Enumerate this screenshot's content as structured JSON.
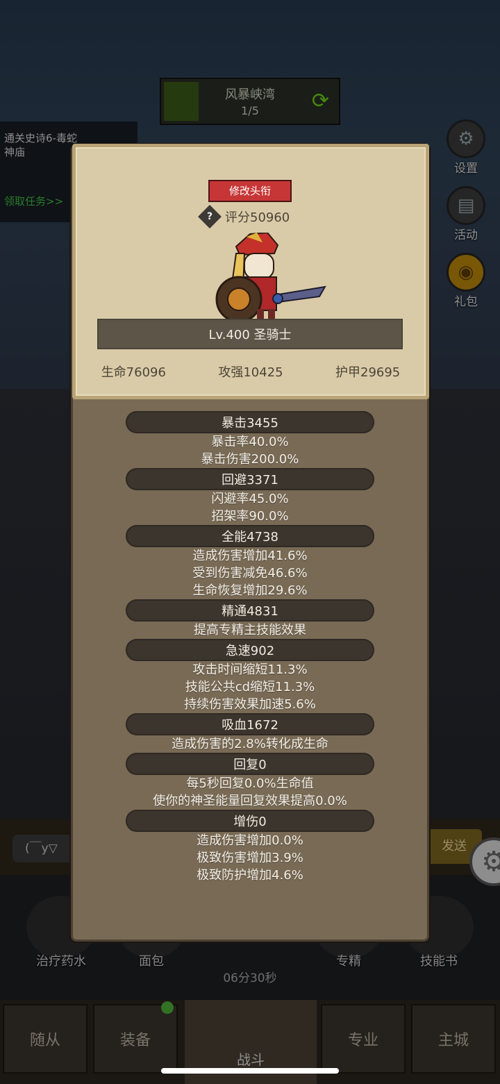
{
  "stage": {
    "name": "风暴峡湾",
    "progress": "1/5"
  },
  "quest": {
    "title": "通关史诗6-毒蛇神庙",
    "claim": "领取任务>>"
  },
  "side_buttons": [
    {
      "label": "设置",
      "icon": "gear-icon"
    },
    {
      "label": "活动",
      "icon": "scroll-icon"
    },
    {
      "label": "礼包",
      "icon": "gift-icon"
    }
  ],
  "profile": {
    "change_title_label": "修改头衔",
    "score_label": "评分50960",
    "name_level": "Lv.400 圣骑士",
    "hp": "生命76096",
    "attack": "攻强10425",
    "armor": "护甲29695"
  },
  "attributes": [
    {
      "header": "暴击3455",
      "lines": [
        "暴击率40.0%",
        "暴击伤害200.0%"
      ]
    },
    {
      "header": "回避3371",
      "lines": [
        "闪避率45.0%",
        "招架率90.0%"
      ]
    },
    {
      "header": "全能4738",
      "lines": [
        "造成伤害增加41.6%",
        "受到伤害减免46.6%",
        "生命恢复增加29.6%"
      ]
    },
    {
      "header": "精通4831",
      "lines": [
        "提高专精主技能效果"
      ]
    },
    {
      "header": "急速902",
      "lines": [
        "攻击时间缩短11.3%",
        "技能公共cd缩短11.3%",
        "持续伤害效果加速5.6%"
      ]
    },
    {
      "header": "吸血1672",
      "lines": [
        "造成伤害的2.8%转化成生命"
      ]
    },
    {
      "header": "回复0",
      "lines": [
        "每5秒回复0.0%生命值",
        "使你的神圣能量回复效果提高0.0%"
      ]
    },
    {
      "header": "增伤0",
      "lines": [
        "造成伤害增加0.0%",
        "极致伤害增加3.9%",
        "极致防护增加4.6%"
      ]
    }
  ],
  "chat": {
    "input_text": "(￣y▽",
    "send_label": "发送"
  },
  "bottom_items": [
    {
      "label": "治疗药水"
    },
    {
      "label": "面包"
    },
    {
      "label": "专精"
    },
    {
      "label": "技能书"
    }
  ],
  "timer": "06分30秒",
  "nav": {
    "followers": "随从",
    "equipment": "装备",
    "battle": "战斗",
    "profession": "专业",
    "main_city": "主城"
  }
}
